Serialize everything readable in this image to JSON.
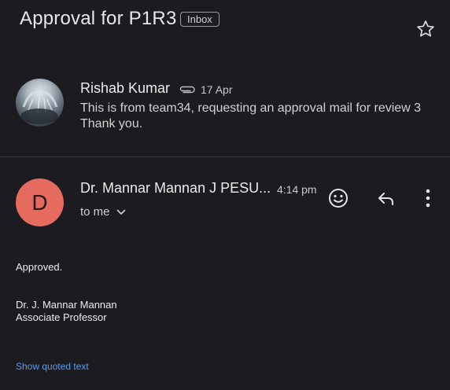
{
  "header": {
    "subject": "Approval for P1R3",
    "label": "Inbox",
    "star_icon": "star-outline-icon"
  },
  "messages": [
    {
      "sender": "Rishab Kumar",
      "date": "17 Apr",
      "attachment_icon": "attachment-icon",
      "snippet_line1": "This is from team34, requesting an approval mail for review 3",
      "snippet_line2": "Thank you."
    },
    {
      "avatar_letter": "D",
      "avatar_color": "#e56b5e",
      "sender": "Dr. Mannar Mannan J PESU...",
      "time": "4:14 pm",
      "recipient": "to me",
      "body": {
        "line1": "Approved.",
        "sig_name": "Dr. J. Mannar Mannan",
        "sig_title": "Associate Professor"
      },
      "show_quoted": "Show quoted text"
    }
  ],
  "colors": {
    "background": "#1b1b20",
    "link": "#5b9be8"
  }
}
